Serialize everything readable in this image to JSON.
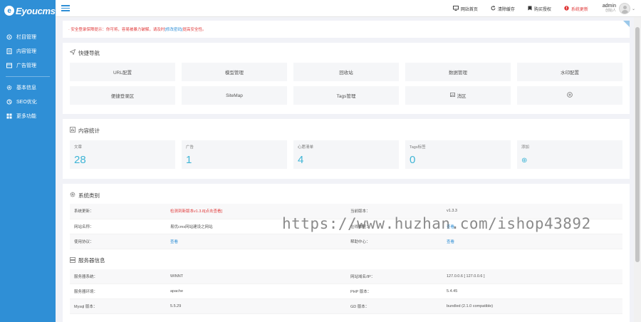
{
  "sidebar": {
    "logo_text": "Eyoucms",
    "items": [
      {
        "label": "栏目管理",
        "icon": "column-icon"
      },
      {
        "label": "内容管理",
        "icon": "document-icon"
      },
      {
        "label": "广告管理",
        "icon": "ad-icon"
      },
      {
        "label": "基本信息",
        "icon": "gear-icon"
      },
      {
        "label": "SEO优化",
        "icon": "seo-icon"
      },
      {
        "label": "更多功能",
        "icon": "grid-icon"
      }
    ]
  },
  "topbar": {
    "links": [
      {
        "label": "网站首页",
        "icon": "monitor-icon"
      },
      {
        "label": "清除缓存",
        "icon": "refresh-icon"
      },
      {
        "label": "购买授权",
        "icon": "bookmark-icon"
      },
      {
        "label": "系统更新",
        "icon": "info-icon"
      }
    ],
    "admin_name": "admin",
    "admin_role": "创始人"
  },
  "notice": {
    "text_before": "· 安全登录保障提示：你可将，容易被暴力破解，请及时",
    "link": "[修改密码]",
    "text_after": "提高安全性。"
  },
  "quick_nav": {
    "title": "快捷导航",
    "buttons": [
      "URL配置",
      "模型管理",
      "回收站",
      "数据管理",
      "水印配置",
      "便捷登录区",
      "SiteMap",
      "Tags管理",
      "",
      ""
    ]
  },
  "content_stats": {
    "title": "内容统计",
    "cards": [
      {
        "label": "文章",
        "value": "28"
      },
      {
        "label": "广告",
        "value": "1"
      },
      {
        "label": "心愿清单",
        "value": "4"
      },
      {
        "label": "Tags标签",
        "value": "0"
      },
      {
        "label": "添加",
        "value": "+"
      }
    ]
  },
  "system": {
    "title": "系统类别",
    "rows": [
      [
        "系统更新：",
        "检测到新版本v1.3.8[点击查看]",
        "当前版本：",
        "v1.3.3"
      ],
      [
        "网站名称：",
        "易优cms网站建设之网站",
        "在线教程：",
        "查看"
      ],
      [
        "使用协议：",
        "查看",
        "帮助中心：",
        "查看"
      ]
    ]
  },
  "server": {
    "title": "服务器信息",
    "rows": [
      [
        "服务器系统：",
        "WINNT",
        "网站域名/IP：",
        "127.0.0.6 [ 127.0.0.6 ]"
      ],
      [
        "服务器环境：",
        "apache",
        "PHP 版本：",
        "5.4.45"
      ],
      [
        "Mysql 版本：",
        "5.5.29",
        "GD 版本：",
        "bundled (2.1.0 compatible)"
      ]
    ]
  },
  "watermark": "https://www.huzhan.com/ishop43892",
  "colors": {
    "sidebar": "#2f8fd6",
    "accent": "#3fb5d6",
    "alert": "#e03a3a"
  }
}
